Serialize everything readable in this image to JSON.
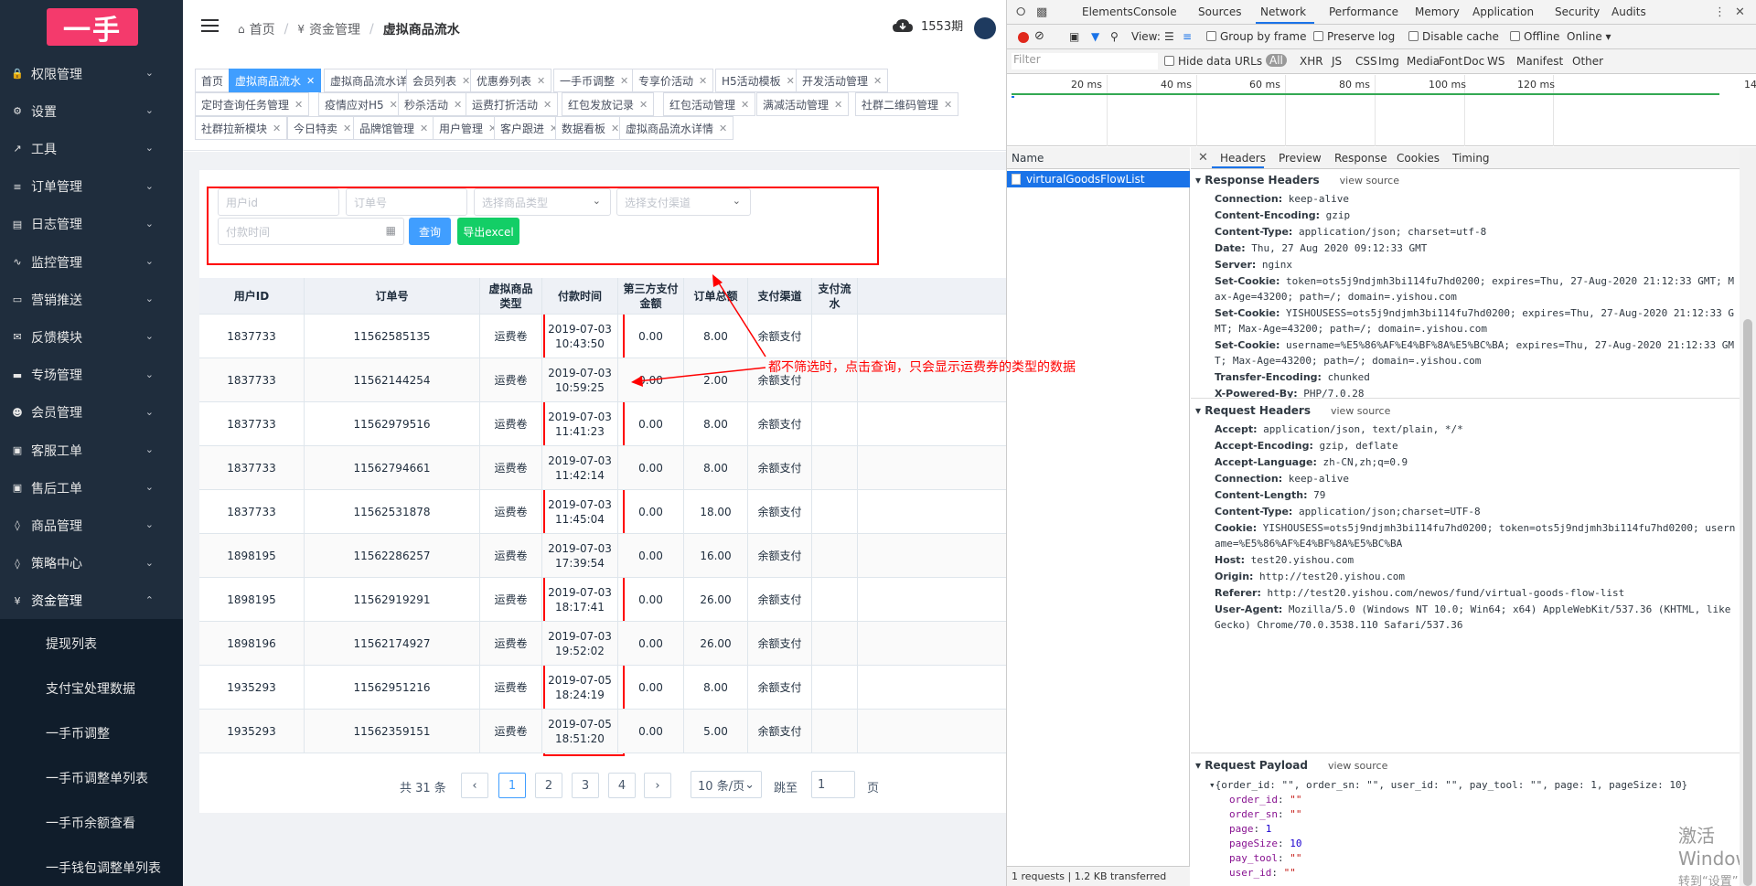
{
  "sidebar": {
    "logo": "一手",
    "menu": [
      {
        "label": "权限管理",
        "icon": "lock-icon"
      },
      {
        "label": "设置",
        "icon": "gear-icon"
      },
      {
        "label": "工具",
        "icon": "wrench-icon"
      },
      {
        "label": "订单管理",
        "icon": "list-icon"
      },
      {
        "label": "日志管理",
        "icon": "log-icon"
      },
      {
        "label": "监控管理",
        "icon": "pulse-icon"
      },
      {
        "label": "营销推送",
        "icon": "card-icon"
      },
      {
        "label": "反馈模块",
        "icon": "mail-icon"
      },
      {
        "label": "专场管理",
        "icon": "stack-icon"
      },
      {
        "label": "会员管理",
        "icon": "users-icon"
      },
      {
        "label": "客服工单",
        "icon": "folder-icon"
      },
      {
        "label": "售后工单",
        "icon": "folder-icon"
      },
      {
        "label": "商品管理",
        "icon": "shirt-icon"
      },
      {
        "label": "策略中心",
        "icon": "shirt-icon"
      },
      {
        "label": "资金管理",
        "icon": "yen-icon"
      }
    ],
    "submenu": [
      "提现列表",
      "支付宝处理数据",
      "一手币调整",
      "一手币调整单列表",
      "一手币余额查看",
      "一手钱包调整单列表"
    ]
  },
  "header": {
    "breadcrumb": [
      "首页",
      "资金管理",
      "虚拟商品流水"
    ],
    "period": "1553期"
  },
  "tags": [
    {
      "label": "首页",
      "closable": false,
      "active": false
    },
    {
      "label": "虚拟商品流水",
      "closable": true,
      "active": true
    },
    {
      "label": "虚拟商品流水详情",
      "closable": true,
      "active": false
    },
    {
      "label": "会员列表",
      "closable": true,
      "active": false
    },
    {
      "label": "优惠券列表",
      "closable": true,
      "active": false
    },
    {
      "label": "一手币调整",
      "closable": true,
      "active": false
    },
    {
      "label": "专享价活动",
      "closable": true,
      "active": false
    },
    {
      "label": "H5活动模板",
      "closable": true,
      "active": false
    },
    {
      "label": "开发活动管理",
      "closable": true,
      "active": false
    },
    {
      "label": "定时查询任务管理",
      "closable": true,
      "active": false
    },
    {
      "label": "疫情应对H5",
      "closable": true,
      "active": false
    },
    {
      "label": "秒杀活动",
      "closable": true,
      "active": false
    },
    {
      "label": "运费打折活动",
      "closable": true,
      "active": false
    },
    {
      "label": "红包发放记录",
      "closable": true,
      "active": false
    },
    {
      "label": "红包活动管理",
      "closable": true,
      "active": false
    },
    {
      "label": "满减活动管理",
      "closable": true,
      "active": false
    },
    {
      "label": "社群二维码管理",
      "closable": true,
      "active": false
    },
    {
      "label": "社群拉新模块",
      "closable": true,
      "active": false
    },
    {
      "label": "今日特卖",
      "closable": true,
      "active": false
    },
    {
      "label": "品牌馆管理",
      "closable": true,
      "active": false
    },
    {
      "label": "用户管理",
      "closable": true,
      "active": false
    },
    {
      "label": "客户跟进",
      "closable": true,
      "active": false
    },
    {
      "label": "数据看板",
      "closable": true,
      "active": false
    },
    {
      "label": "虚拟商品流水详情",
      "closable": true,
      "active": false
    }
  ],
  "filters": {
    "user_id_placeholder": "用户id",
    "order_sn_placeholder": "订单号",
    "goods_type_placeholder": "选择商品类型",
    "pay_channel_placeholder": "选择支付渠道",
    "pay_time_placeholder": "付款时间",
    "search_label": "查询",
    "export_label": "导出excel"
  },
  "table": {
    "columns": [
      "用户ID",
      "订单号",
      "虚拟商品类型",
      "付款时间",
      "第三方支付金额",
      "订单总额",
      "支付渠道",
      "支付流水"
    ],
    "rows": [
      [
        "1837733",
        "11562585135",
        "运费卷",
        "2019-07-03 10:43:50",
        "0.00",
        "8.00",
        "余额支付",
        ""
      ],
      [
        "1837733",
        "11562144254",
        "运费卷",
        "2019-07-03 10:59:25",
        "0.00",
        "2.00",
        "余额支付",
        ""
      ],
      [
        "1837733",
        "11562979516",
        "运费卷",
        "2019-07-03 11:41:23",
        "0.00",
        "8.00",
        "余额支付",
        ""
      ],
      [
        "1837733",
        "11562794661",
        "运费卷",
        "2019-07-03 11:42:14",
        "0.00",
        "8.00",
        "余额支付",
        ""
      ],
      [
        "1837733",
        "11562531878",
        "运费卷",
        "2019-07-03 11:45:04",
        "0.00",
        "18.00",
        "余额支付",
        ""
      ],
      [
        "1898195",
        "11562286257",
        "运费卷",
        "2019-07-03 17:39:54",
        "0.00",
        "16.00",
        "余额支付",
        ""
      ],
      [
        "1898195",
        "11562919291",
        "运费卷",
        "2019-07-03 18:17:41",
        "0.00",
        "26.00",
        "余额支付",
        ""
      ],
      [
        "1898196",
        "11562174927",
        "运费卷",
        "2019-07-03 19:52:02",
        "0.00",
        "26.00",
        "余额支付",
        ""
      ],
      [
        "1935293",
        "11562951216",
        "运费卷",
        "2019-07-05 18:24:19",
        "0.00",
        "8.00",
        "余额支付",
        ""
      ],
      [
        "1935293",
        "11562359151",
        "运费卷",
        "2019-07-05 18:51:20",
        "0.00",
        "5.00",
        "余额支付",
        ""
      ]
    ]
  },
  "pagination": {
    "total": "共 31 条",
    "pages": [
      "1",
      "2",
      "3",
      "4"
    ],
    "current": "1",
    "page_size": "10 条/页",
    "jump_label": "跳至",
    "jump_value": "1",
    "page_suffix": "页"
  },
  "annotation": "都不筛选时，点击查询，只会显示运费券的类型的数据",
  "devtools": {
    "tabs": [
      "Elements",
      "Console",
      "Sources",
      "Network",
      "Performance",
      "Memory",
      "Application",
      "Security",
      "Audits"
    ],
    "active_tab": "Network",
    "toolbar": {
      "view": "View:",
      "group_by_frame": "Group by frame",
      "preserve_log": "Preserve log",
      "disable_cache": "Disable cache",
      "offline": "Offline",
      "online": "Online"
    },
    "filter_placeholder": "Filter",
    "filter_types": [
      "Hide data URLs",
      "All",
      "XHR",
      "JS",
      "CSS",
      "Img",
      "Media",
      "Font",
      "Doc",
      "WS",
      "Manifest",
      "Other"
    ],
    "timeline_labels": [
      "20 ms",
      "40 ms",
      "60 ms",
      "80 ms",
      "100 ms",
      "120 ms",
      "14"
    ],
    "name_header": "Name",
    "request_name": "virturalGoodsFlowList",
    "footer": "1 requests | 1.2 KB transferred",
    "detail_tabs": [
      "Headers",
      "Preview",
      "Response",
      "Cookies",
      "Timing"
    ],
    "response_headers_title": "Response Headers",
    "request_headers_title": "Request Headers",
    "payload_title": "Request Payload",
    "view_source": "view source",
    "response_headers": [
      {
        "k": "Connection:",
        "v": "keep-alive"
      },
      {
        "k": "Content-Encoding:",
        "v": "gzip"
      },
      {
        "k": "Content-Type:",
        "v": "application/json; charset=utf-8"
      },
      {
        "k": "Date:",
        "v": "Thu, 27 Aug 2020 09:12:33 GMT"
      },
      {
        "k": "Server:",
        "v": "nginx"
      },
      {
        "k": "Set-Cookie:",
        "v": "token=ots5j9ndjmh3bi114fu7hd0200; expires=Thu, 27-Aug-2020 21:12:33 GMT; Max-Age=43200; path=/; domain=.yishou.com"
      },
      {
        "k": "Set-Cookie:",
        "v": "YISHOUSESS=ots5j9ndjmh3bi114fu7hd0200; expires=Thu, 27-Aug-2020 21:12:33 GMT; Max-Age=43200; path=/; domain=.yishou.com"
      },
      {
        "k": "Set-Cookie:",
        "v": "username=%E5%86%AF%E4%BF%8A%E5%BC%BA; expires=Thu, 27-Aug-2020 21:12:33 GMT; Max-Age=43200; path=/; domain=.yishou.com"
      },
      {
        "k": "Transfer-Encoding:",
        "v": "chunked"
      },
      {
        "k": "X-Powered-By:",
        "v": "PHP/7.0.28"
      }
    ],
    "request_headers": [
      {
        "k": "Accept:",
        "v": "application/json, text/plain, */*"
      },
      {
        "k": "Accept-Encoding:",
        "v": "gzip, deflate"
      },
      {
        "k": "Accept-Language:",
        "v": "zh-CN,zh;q=0.9"
      },
      {
        "k": "Connection:",
        "v": "keep-alive"
      },
      {
        "k": "Content-Length:",
        "v": "79"
      },
      {
        "k": "Content-Type:",
        "v": "application/json;charset=UTF-8"
      },
      {
        "k": "Cookie:",
        "v": "YISHOUSESS=ots5j9ndjmh3bi114fu7hd0200; token=ots5j9ndjmh3bi114fu7hd0200; username=%E5%86%AF%E4%BF%8A%E5%BC%BA"
      },
      {
        "k": "Host:",
        "v": "test20.yishou.com"
      },
      {
        "k": "Origin:",
        "v": "http://test20.yishou.com"
      },
      {
        "k": "Referer:",
        "v": "http://test20.yishou.com/newos/fund/virtual-goods-flow-list"
      },
      {
        "k": "User-Agent:",
        "v": "Mozilla/5.0 (Windows NT 10.0; Win64; x64) AppleWebKit/537.36 (KHTML, like Gecko) Chrome/70.0.3538.110 Safari/537.36"
      }
    ],
    "payload_summary": "{order_id: \"\", order_sn: \"\", user_id: \"\", pay_tool: \"\", page: 1, pageSize: 10}",
    "payload_fields": [
      {
        "k": "order_id",
        "v": "\"\"",
        "t": "str"
      },
      {
        "k": "order_sn",
        "v": "\"\"",
        "t": "str"
      },
      {
        "k": "page",
        "v": "1",
        "t": "num"
      },
      {
        "k": "pageSize",
        "v": "10",
        "t": "num"
      },
      {
        "k": "pay_tool",
        "v": "\"\"",
        "t": "str"
      },
      {
        "k": "user_id",
        "v": "\"\"",
        "t": "str"
      }
    ],
    "watermark": [
      "激活 Windows",
      "转到“设置”以激活 Windows。"
    ]
  }
}
